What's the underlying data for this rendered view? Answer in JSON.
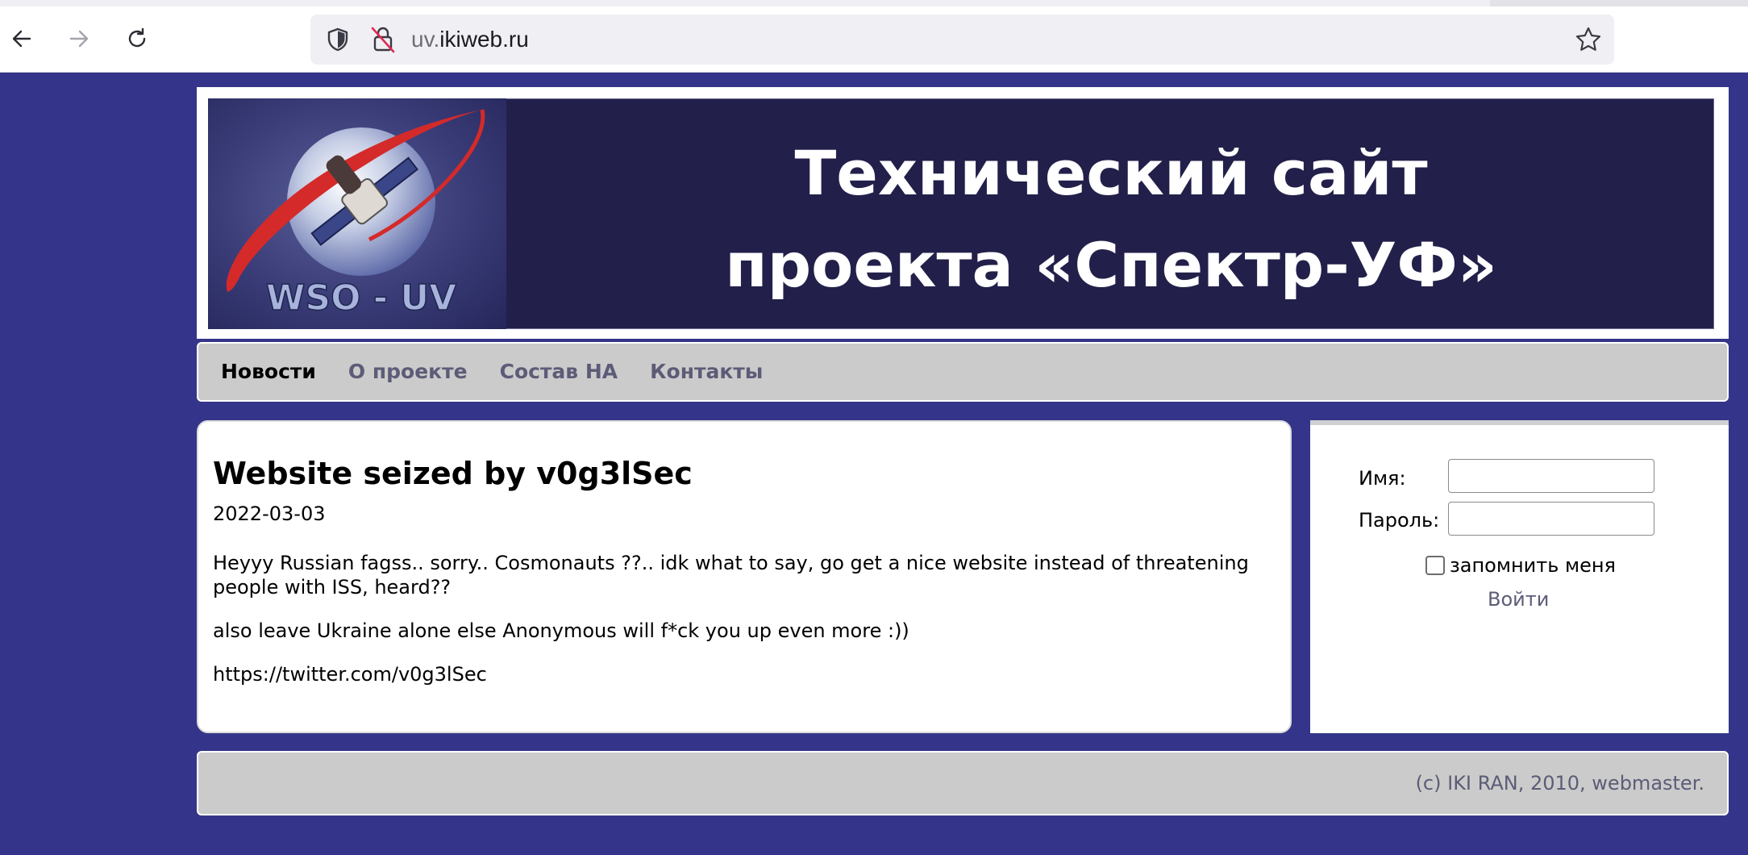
{
  "browser": {
    "url_prefix": "uv.",
    "url_domain": "ikiweb.ru"
  },
  "banner": {
    "logo_text": "WSO - UV",
    "title": "Технический сайт\nпроекта «Спектр-УФ»"
  },
  "nav": {
    "items": [
      {
        "label": "Новости",
        "active": true
      },
      {
        "label": "О проекте",
        "active": false
      },
      {
        "label": "Состав НА",
        "active": false
      },
      {
        "label": "Контакты",
        "active": false
      }
    ]
  },
  "post": {
    "title": "Website seized by v0g3lSec",
    "date": "2022-03-03",
    "paragraphs": [
      "Heyyy Russian fagss.. sorry.. Cosmonauts ??.. idk what to say, go get a nice website instead of threatening people with ISS, heard??",
      "also leave Ukraine alone else Anonymous will f*ck you up even more :))",
      "https://twitter.com/v0g3lSec"
    ]
  },
  "login": {
    "name_label": "Имя:",
    "password_label": "Пароль:",
    "name_value": "",
    "password_value": "",
    "remember_label": "запомнить меня",
    "remember_checked": false,
    "submit_label": "Войти"
  },
  "footer": {
    "text": "(c) IKI RAN, 2010, webmaster."
  },
  "colors": {
    "page_background": "#34358a",
    "banner_background": "#22204a",
    "nav_background": "#cbcbcb",
    "muted_link": "#5c5c78"
  }
}
